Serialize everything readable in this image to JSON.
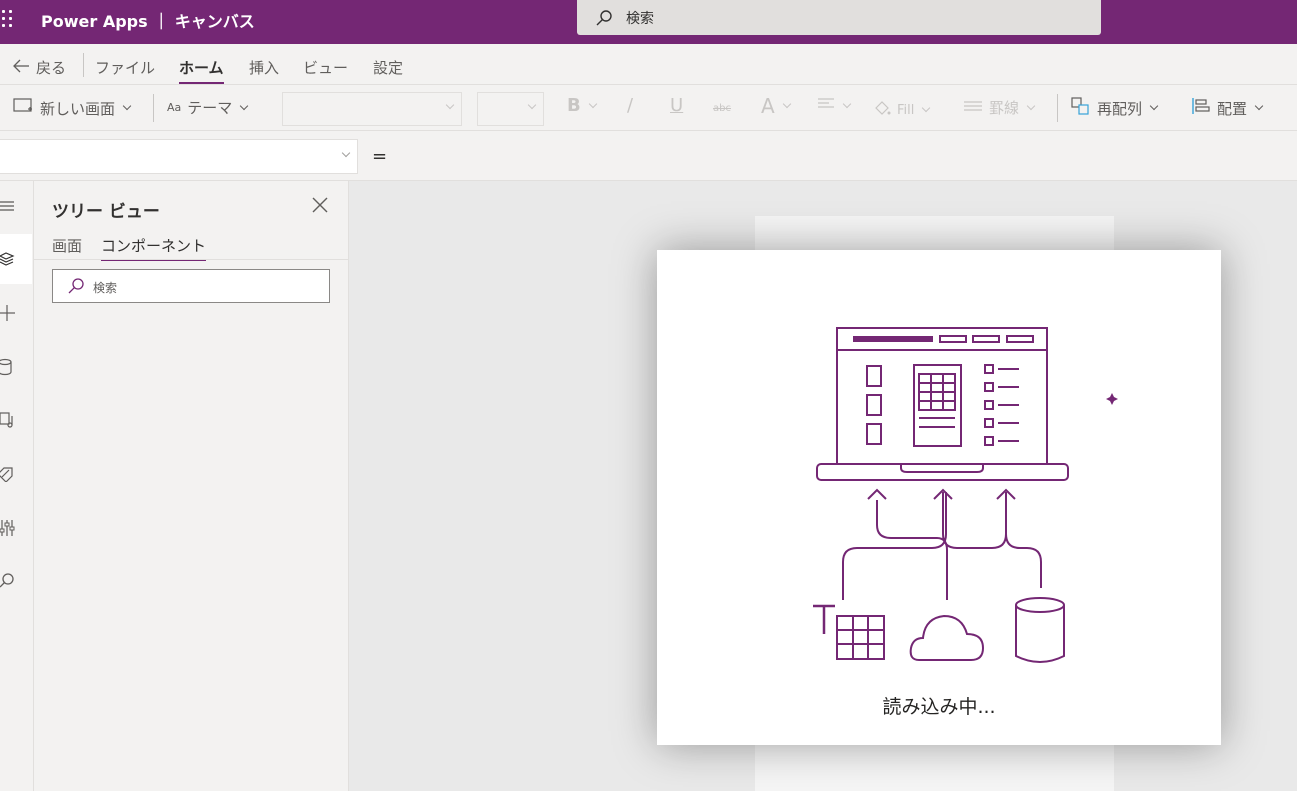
{
  "header": {
    "app_title": "Power Apps ｜ キャンバス",
    "search_placeholder": "検索",
    "background_color": "#742774"
  },
  "menu": {
    "back_label": "戻る",
    "items": [
      {
        "label": "ファイル",
        "active": false
      },
      {
        "label": "ホーム",
        "active": true
      },
      {
        "label": "挿入",
        "active": false
      },
      {
        "label": "ビュー",
        "active": false
      },
      {
        "label": "設定",
        "active": false
      }
    ]
  },
  "ribbon": {
    "new_screen_label": "新しい画面",
    "theme_label": "テーマ",
    "bold_label": "B",
    "italic_label": "/",
    "underline_label": "U",
    "strike_label": "abc",
    "font_color_label": "A",
    "fill_label": "Fill",
    "border_label": "罫線",
    "reorder_label": "再配列",
    "align_label": "配置"
  },
  "formula_bar": {
    "equals": "="
  },
  "left_rail": {
    "icons": [
      "menu-icon",
      "layers-icon",
      "plus-icon",
      "database-icon",
      "media-icon",
      "tag-icon",
      "advanced-tools-icon",
      "search-icon"
    ]
  },
  "tree_view": {
    "title": "ツリー ビュー",
    "tabs": [
      {
        "label": "画面",
        "active": false
      },
      {
        "label": "コンポーネント",
        "active": true
      }
    ],
    "search_placeholder": "検索"
  },
  "loading": {
    "text": "読み込み中...",
    "accent_color": "#742774"
  }
}
